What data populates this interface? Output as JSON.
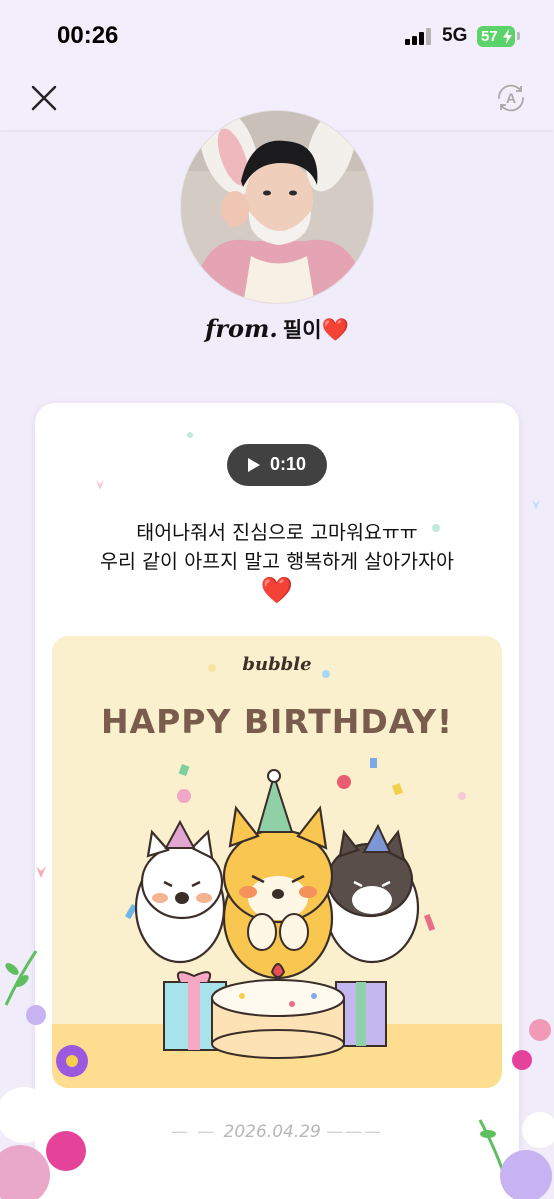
{
  "status_bar": {
    "time": "00:26",
    "network": "5G",
    "battery": "57"
  },
  "nav": {
    "close_icon": "close-icon",
    "translate_icon": "translate-icon"
  },
  "profile": {
    "from_label": "from.",
    "name": "필이",
    "heart": "❤️"
  },
  "message_card": {
    "audio_duration": "0:10",
    "text_line1": "태어나줘서 진심으로 고마워요ㅠㅠ",
    "text_line2": "우리 같이 아프지 말고 행복하게 살아가자아",
    "heart": "❤️"
  },
  "birthday_card": {
    "logo": "bubble",
    "title": "HAPPY BIRTHDAY!"
  },
  "footer": {
    "date": "2026.04.29"
  },
  "colors": {
    "background": "#f1ecfa",
    "card": "#ffffff",
    "audio_pill": "#414141",
    "birthday_bg": "#faf0cd",
    "birthday_title": "#7a5c4d",
    "battery": "#5bd36a"
  }
}
